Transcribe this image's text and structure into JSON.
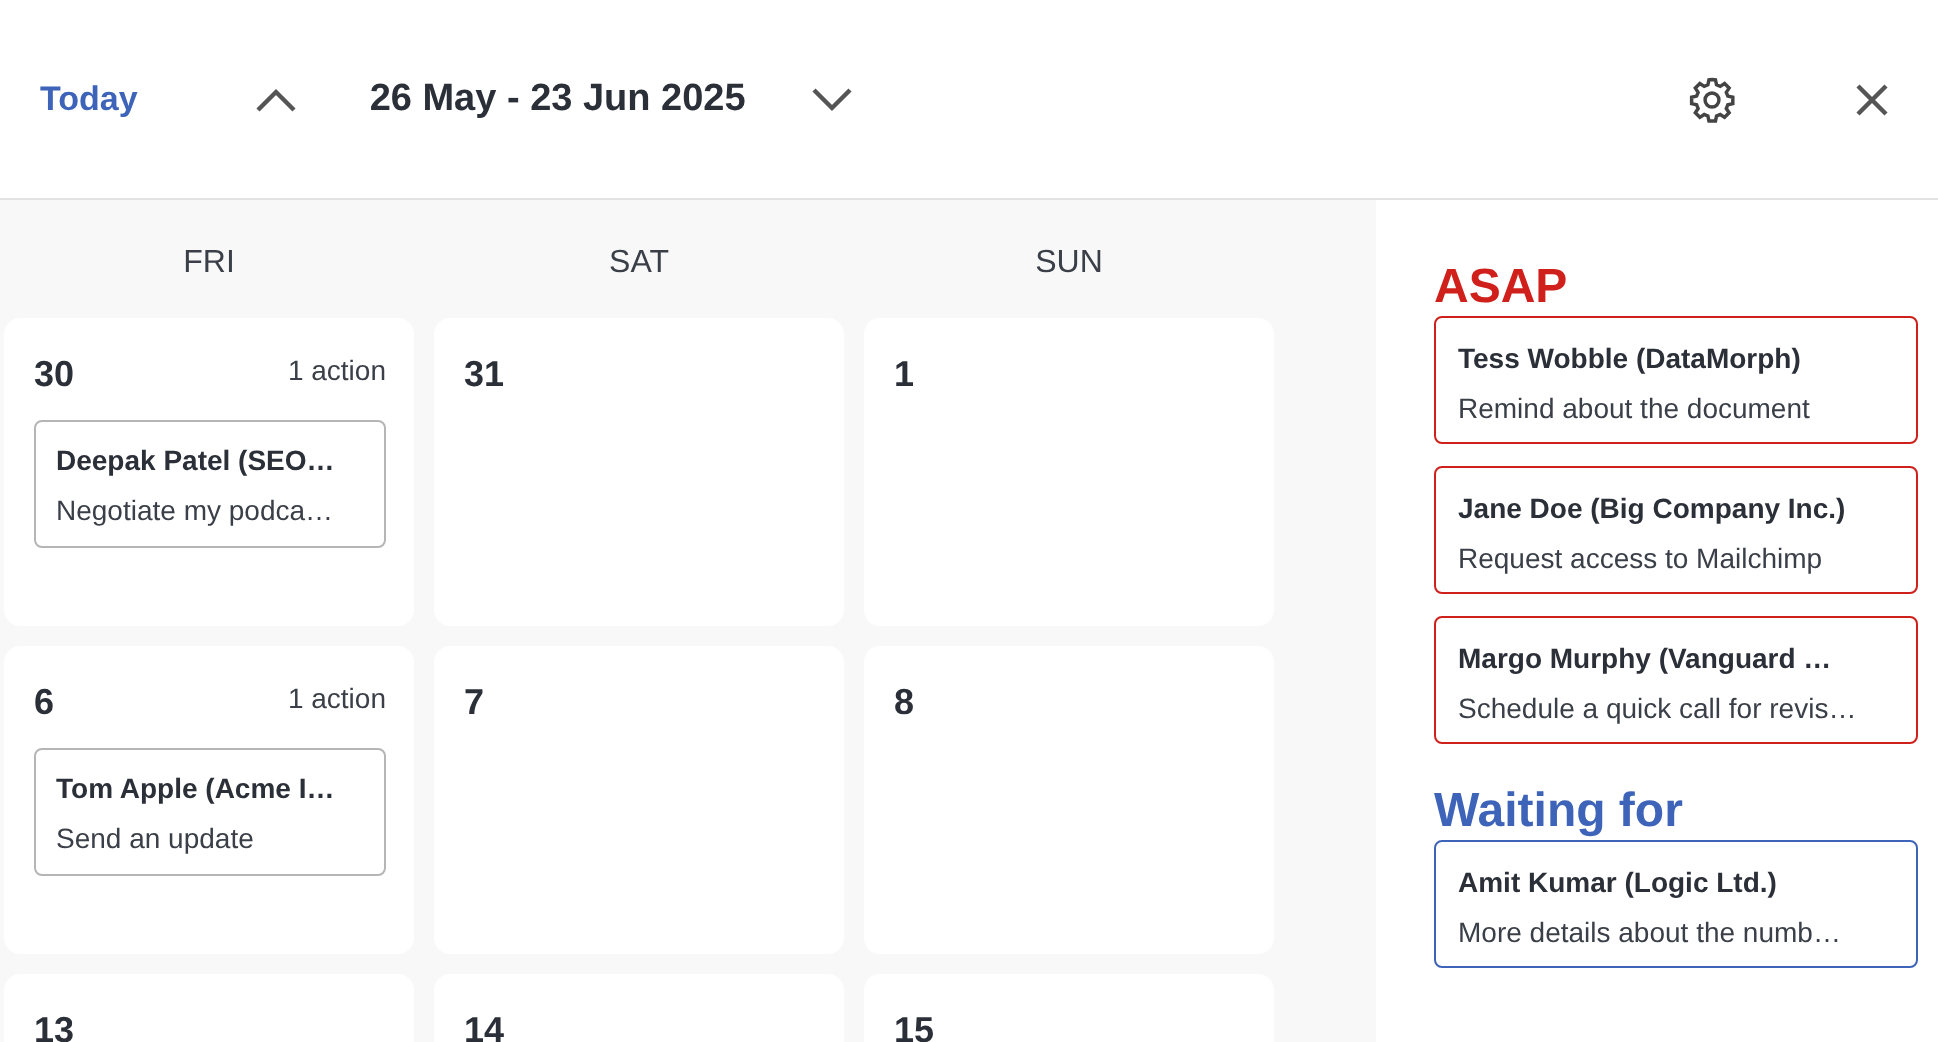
{
  "header": {
    "today_button": "Today",
    "range": "26 May - 23 Jun 2025"
  },
  "calendar": {
    "weekdays": [
      "FRI",
      "SAT",
      "SUN"
    ],
    "weeks": [
      {
        "days": [
          {
            "date": "30",
            "count": "1 action",
            "actions": [
              {
                "contact": "Deepak Patel (SEO…",
                "task": "Negotiate my podca…"
              }
            ]
          },
          {
            "date": "31"
          },
          {
            "date": "1"
          }
        ]
      },
      {
        "days": [
          {
            "date": "6",
            "count": "1 action",
            "actions": [
              {
                "contact": "Tom Apple (Acme I…",
                "task": "Send an update"
              }
            ]
          },
          {
            "date": "7"
          },
          {
            "date": "8"
          }
        ]
      },
      {
        "days": [
          {
            "date": "13"
          },
          {
            "date": "14"
          },
          {
            "date": "15"
          }
        ]
      }
    ]
  },
  "sidebar": {
    "sections": [
      {
        "title": "ASAP",
        "color": "#d0201c",
        "items": [
          {
            "contact": "Tess Wobble (DataMorph)",
            "task": "Remind about the document"
          },
          {
            "contact": "Jane Doe (Big Company Inc.)",
            "task": "Request access to Mailchimp"
          },
          {
            "contact": "Margo Murphy (Vanguard …",
            "task": "Schedule a quick call for revis…"
          }
        ]
      },
      {
        "title": "Waiting for",
        "color": "#3d64b8",
        "items": [
          {
            "contact": "Amit Kumar (Logic Ltd.)",
            "task": "More details about the numb…"
          }
        ]
      }
    ]
  }
}
